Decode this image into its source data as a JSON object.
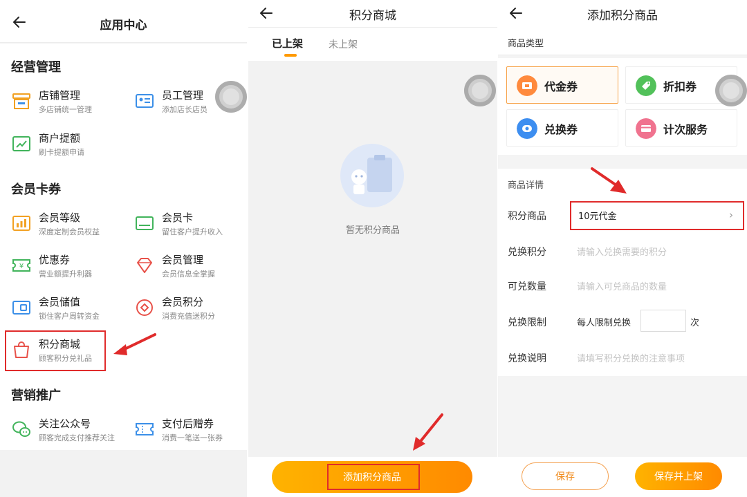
{
  "app_center": {
    "title": "应用中心",
    "sections": [
      {
        "title": "经营管理",
        "items": [
          {
            "name": "店铺管理",
            "desc": "多店铺统一管理",
            "icon": "store-icon"
          },
          {
            "name": "员工管理",
            "desc": "添加店长店员",
            "icon": "staff-card-icon"
          },
          {
            "name": "商户提额",
            "desc": "刷卡提额申请",
            "icon": "chart-up-icon"
          }
        ]
      },
      {
        "title": "会员卡券",
        "items": [
          {
            "name": "会员等级",
            "desc": "深度定制会员权益",
            "icon": "bar-level-icon"
          },
          {
            "name": "会员卡",
            "desc": "留住客户提升收入",
            "icon": "member-card-icon"
          },
          {
            "name": "优惠券",
            "desc": "营业额提升利器",
            "icon": "coupon-icon"
          },
          {
            "name": "会员管理",
            "desc": "会员信息全掌握",
            "icon": "diamond-icon"
          },
          {
            "name": "会员储值",
            "desc": "锁住客户周转资金",
            "icon": "wallet-icon"
          },
          {
            "name": "会员积分",
            "desc": "消费充值送积分",
            "icon": "points-icon"
          },
          {
            "name": "积分商城",
            "desc": "顾客积分兑礼品",
            "icon": "shopping-bag-icon"
          }
        ]
      },
      {
        "title": "营销推广",
        "items": [
          {
            "name": "关注公众号",
            "desc": "顾客完成支付推荐关注",
            "icon": "wechat-icon"
          },
          {
            "name": "支付后赠券",
            "desc": "消费一笔送一张券",
            "icon": "ticket-icon"
          }
        ]
      }
    ]
  },
  "points_mall": {
    "title": "积分商城",
    "tab_active": "已上架",
    "tab_inactive": "未上架",
    "empty_text": "暂无积分商品",
    "add_button": "添加积分商品"
  },
  "add_product": {
    "title": "添加积分商品",
    "type_label": "商品类型",
    "types": [
      {
        "name": "代金券",
        "icon": "voucher-icon",
        "color": "#ff8a3d"
      },
      {
        "name": "折扣券",
        "icon": "discount-tag-icon",
        "color": "#52c15a"
      },
      {
        "name": "兑换券",
        "icon": "exchange-icon",
        "color": "#3d8ef0"
      },
      {
        "name": "计次服务",
        "icon": "card-service-icon",
        "color": "#f0738f"
      }
    ],
    "detail_heading": "商品详情",
    "fields": {
      "product": {
        "label": "积分商品",
        "value": "10元代金"
      },
      "points": {
        "label": "兑换积分",
        "placeholder": "请输入兑换需要的积分"
      },
      "quantity": {
        "label": "可兑数量",
        "placeholder": "请输入可兑商品的数量"
      },
      "limit": {
        "label": "兑换限制",
        "prefix": "每人限制兑换",
        "unit": "次"
      },
      "description": {
        "label": "兑换说明",
        "placeholder": "请填写积分兑换的注意事项"
      }
    },
    "save_button": "保存",
    "save_publish_button": "保存并上架"
  },
  "colors": {
    "accent": "#ff9a00",
    "highlight": "#e02b2b"
  }
}
